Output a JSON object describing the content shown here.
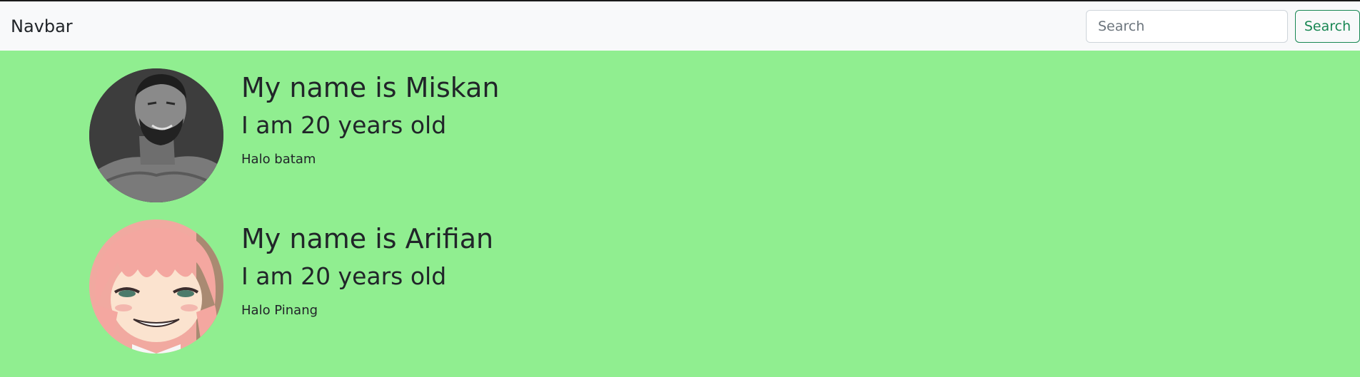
{
  "navbar": {
    "brand": "Navbar",
    "search_placeholder": "Search",
    "search_button_label": "Search",
    "button_color": "#198754"
  },
  "page": {
    "background_color": "#90ee90"
  },
  "profiles": [
    {
      "name_text": "My name is Miskan",
      "age_text": "I am 20 years old",
      "greeting": "Halo batam",
      "avatar_icon": "grayscale-man-portrait-icon"
    },
    {
      "name_text": "My name is Arifian",
      "age_text": "I am 20 years old",
      "greeting": "Halo Pinang",
      "avatar_icon": "anime-pink-hair-girl-icon"
    }
  ]
}
